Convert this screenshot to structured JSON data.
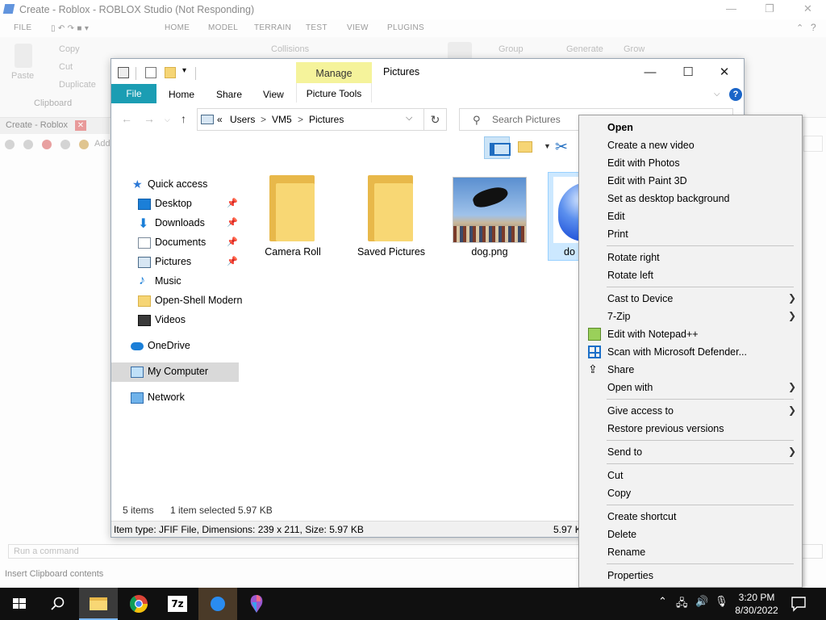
{
  "studio": {
    "title": "Create - Roblox - ROBLOX Studio (Not Responding)",
    "ribbon_tabs": [
      "FILE",
      "HOME",
      "MODEL",
      "TERRAIN",
      "TEST",
      "VIEW",
      "PLUGINS"
    ],
    "ribbon": {
      "paste": "Paste",
      "copy": "Copy",
      "cut": "Cut",
      "duplicate": "Duplicate",
      "clipboard_group": "Clipboard",
      "collisions": "Collisions",
      "group": "Group",
      "generate": "Generate",
      "grow": "Grow"
    },
    "doc_tab": "Create - Roblox",
    "toolrow_add": "Add",
    "command_placeholder": "Run a command",
    "status": "Insert Clipboard contents"
  },
  "explorer": {
    "title": "Pictures",
    "manage_tab": "Manage",
    "picture_tools_tab": "Picture Tools",
    "tabs": {
      "file": "File",
      "home": "Home",
      "share": "Share",
      "view": "View"
    },
    "address": {
      "prefix": "«",
      "segments": [
        "Users",
        "VM5",
        "Pictures"
      ],
      "separator": ">"
    },
    "search_placeholder": "Search Pictures",
    "nav": [
      {
        "label": "Quick access",
        "icon": "star-icon"
      },
      {
        "label": "Desktop",
        "icon": "desktop-icon",
        "pinned": true
      },
      {
        "label": "Downloads",
        "icon": "download-icon",
        "pinned": true
      },
      {
        "label": "Documents",
        "icon": "documents-icon",
        "pinned": true
      },
      {
        "label": "Pictures",
        "icon": "pictures-icon",
        "pinned": true
      },
      {
        "label": "Music",
        "icon": "music-icon"
      },
      {
        "label": "Open-Shell Modern",
        "icon": "folder-icon"
      },
      {
        "label": "Videos",
        "icon": "videos-icon"
      },
      {
        "label": "OneDrive",
        "icon": "cloud-icon"
      },
      {
        "label": "My Computer",
        "icon": "computer-icon",
        "selected": true
      },
      {
        "label": "Network",
        "icon": "network-icon"
      }
    ],
    "files": [
      {
        "name": "Camera Roll",
        "kind": "folder"
      },
      {
        "name": "Saved Pictures",
        "kind": "folder"
      },
      {
        "name": "dog.png",
        "kind": "image"
      },
      {
        "name": "do",
        "kind": "image",
        "selected": true
      }
    ],
    "status": {
      "count": "5 items",
      "selection": "1 item selected  5.97 KB"
    },
    "details": {
      "left": "Item type: JFIF File, Dimensions: 239 x 211, Size: 5.97 KB",
      "right": "5.97 K"
    }
  },
  "context_menu": {
    "items": [
      {
        "label": "Open",
        "bold": true
      },
      {
        "label": "Create a new video"
      },
      {
        "label": "Edit with Photos"
      },
      {
        "label": "Edit with Paint 3D"
      },
      {
        "label": "Set as desktop background"
      },
      {
        "label": "Edit"
      },
      {
        "label": "Print"
      },
      {
        "sep": true
      },
      {
        "label": "Rotate right"
      },
      {
        "label": "Rotate left"
      },
      {
        "sep": true
      },
      {
        "label": "Cast to Device",
        "submenu": true
      },
      {
        "label": "7-Zip",
        "submenu": true
      },
      {
        "label": "Edit with Notepad++",
        "icon": "notepadpp-icon"
      },
      {
        "label": "Scan with Microsoft Defender...",
        "icon": "defender-icon"
      },
      {
        "label": "Share",
        "icon": "share-icon"
      },
      {
        "label": "Open with",
        "submenu": true
      },
      {
        "sep": true
      },
      {
        "label": "Give access to",
        "submenu": true
      },
      {
        "label": "Restore previous versions"
      },
      {
        "sep": true
      },
      {
        "label": "Send to",
        "submenu": true
      },
      {
        "sep": true
      },
      {
        "label": "Cut"
      },
      {
        "label": "Copy"
      },
      {
        "sep": true
      },
      {
        "label": "Create shortcut"
      },
      {
        "label": "Delete"
      },
      {
        "label": "Rename"
      },
      {
        "sep": true
      },
      {
        "label": "Properties"
      }
    ]
  },
  "taskbar": {
    "apps": [
      "start-icon",
      "search-icon",
      "file-explorer-icon",
      "chrome-icon",
      "7zip-icon",
      "roblox-studio-icon",
      "paint-icon"
    ],
    "time": "3:20 PM",
    "date": "8/30/2022",
    "sevenzip_label": "7z"
  },
  "colors": {
    "accent": "#1b9db3",
    "manage": "#f5f39b",
    "selection": "#cce8ff"
  }
}
